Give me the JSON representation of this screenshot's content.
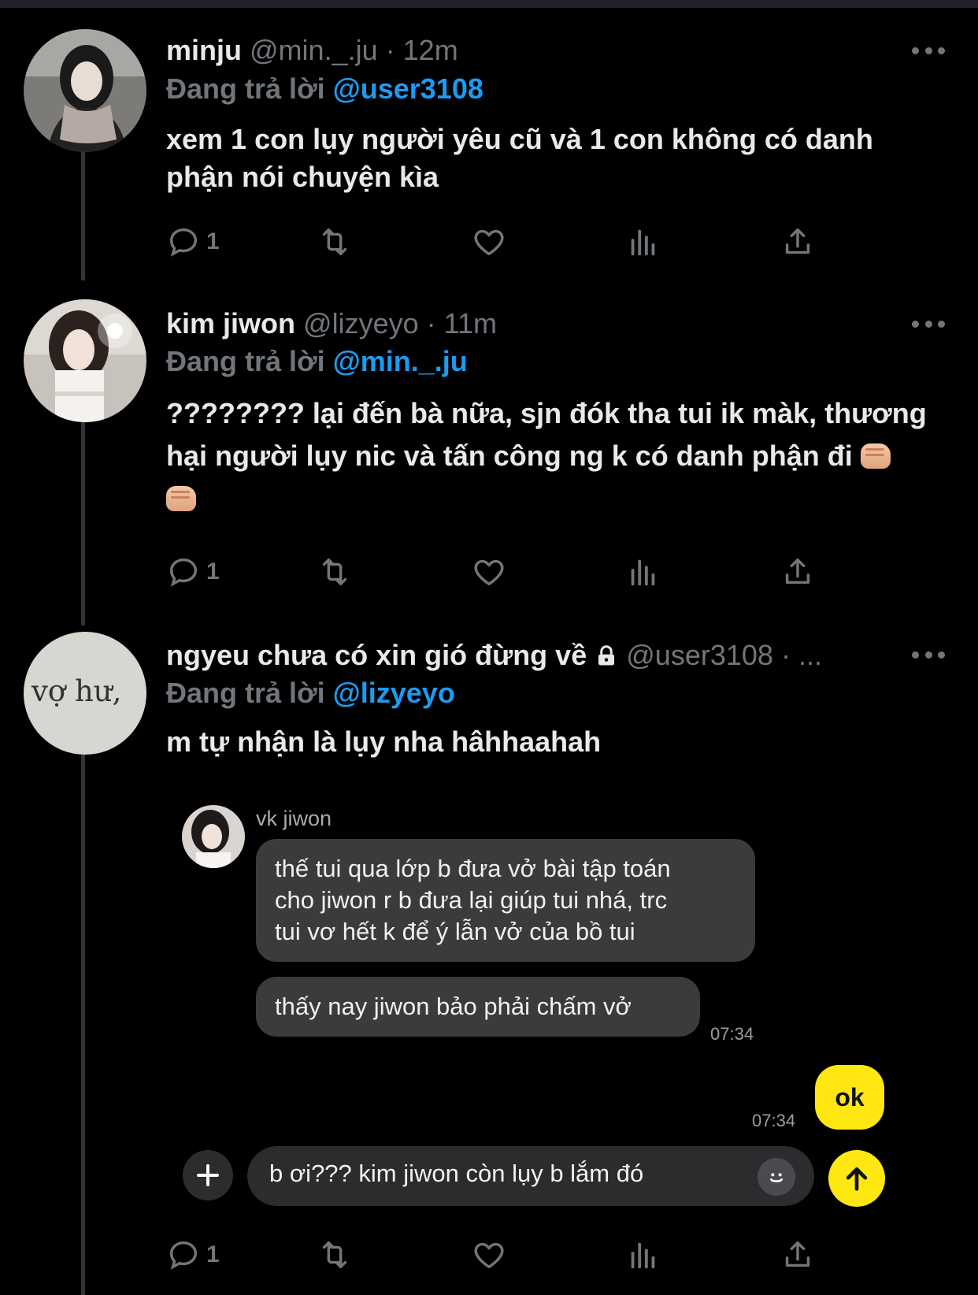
{
  "tweets": [
    {
      "name": "minju",
      "handle": "@min._.ju",
      "sep": "·",
      "time": "12m",
      "reply_prefix": "Đang trả lời",
      "reply_to": "@user3108",
      "text": "xem 1 con lụy người yêu cũ và 1 con không có danh phận nói chuyện kìa",
      "reply_count": "1"
    },
    {
      "name": "kim jiwon",
      "handle": "@lizyeyo",
      "sep": "·",
      "time": "11m",
      "reply_prefix": "Đang trả lời",
      "reply_to": "@min._.ju",
      "text_line1": "???????? lại đến bà nữa, sjn đók tha tui ik màk, thương",
      "text_line2": "hại người lụy nic và tấn công ng k có danh phận đi",
      "reply_count": "1"
    },
    {
      "name": "ngyeu chưa có xin gió đừng về",
      "handle": "@user3108",
      "sep": "·",
      "time": "...",
      "reply_prefix": "Đang trả lời",
      "reply_to": "@lizyeyo",
      "text": "m tự nhận là lụy nha hâhhaahah",
      "reply_count": "1"
    }
  ],
  "chat": {
    "contact_name": "vk jiwon",
    "messages": [
      {
        "line1": "thế tui qua lớp b đưa vở bài tập toán",
        "line2": "cho jiwon r b đưa lại giúp tui nhá, trc",
        "line3": "tui vơ hết k để ý lẫn vở của bồ tui"
      },
      {
        "text": "thấy nay jiwon bảo phải chấm vở",
        "time": "07:34"
      }
    ],
    "own_message": {
      "text": "ok",
      "time": "07:34"
    },
    "input_text": "b ơi??? kim jiwon còn lụy b lắm đó",
    "accent_color": "#ffe812"
  },
  "avatar_text": "vợ hư,",
  "icons": [
    "reply-icon",
    "retweet-icon",
    "like-icon",
    "views-icon",
    "share-icon",
    "more-icon",
    "lock-icon",
    "plus-icon",
    "smile-icon",
    "send-arrow-icon"
  ],
  "colors": {
    "link": "#1d9bf0",
    "muted": "#71767b",
    "background": "#000000"
  }
}
